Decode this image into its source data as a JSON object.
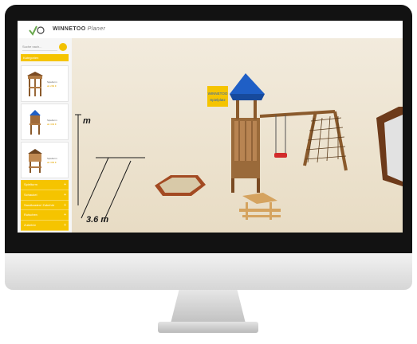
{
  "app": {
    "brand": "WINNETOO",
    "brand_sub": "Planer"
  },
  "sidebar": {
    "search_placeholder": "Suche nach...",
    "category_tab": "Kategorien",
    "products": [
      {
        "name": "Spielturm",
        "price": "ab 299 €",
        "icon": "gazebo-tower-icon"
      },
      {
        "name": "Spielturm",
        "price": "ab 349 €",
        "icon": "blue-roof-tower-icon"
      },
      {
        "name": "Spielturm",
        "price": "ab 399 €",
        "icon": "hexagon-tower-icon"
      }
    ],
    "categories": [
      "Spielturm",
      "Schaukel",
      "Sandkasten/ Zubehör",
      "Rutschen",
      "Zubehör"
    ]
  },
  "scene": {
    "dimension_top": "m",
    "dimension_bottom": "3.6 m",
    "sign_lines": [
      "WINNETOO",
      "Spielplatz"
    ]
  },
  "colors": {
    "accent": "#f5c400",
    "floor": "#ede5d4",
    "roof": "#1f5fc6",
    "wood": "#a06b3a"
  }
}
